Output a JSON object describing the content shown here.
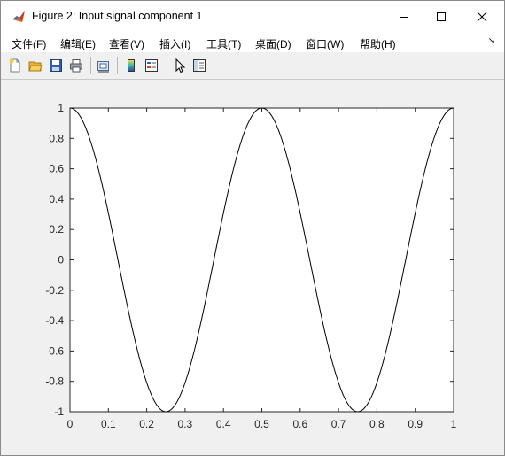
{
  "window": {
    "title": "Figure 2: Input signal component 1",
    "icons": [
      "matlab-logo-icon",
      "minimize-icon",
      "maximize-icon",
      "close-icon"
    ]
  },
  "menubar": {
    "items": [
      {
        "label": "文件(F)"
      },
      {
        "label": "编辑(E)"
      },
      {
        "label": "查看(V)"
      },
      {
        "label": "插入(I)"
      },
      {
        "label": "工具(T)"
      },
      {
        "label": "桌面(D)"
      },
      {
        "label": "窗口(W)"
      },
      {
        "label": "帮助(H)"
      }
    ],
    "overflow_glyph": "↘"
  },
  "toolbar": {
    "buttons": [
      {
        "icon": "new-figure-icon"
      },
      {
        "icon": "open-file-icon"
      },
      {
        "icon": "save-icon"
      },
      {
        "icon": "print-icon"
      },
      {
        "icon": "link-plot-icon"
      },
      {
        "icon": "insert-colorbar-icon"
      },
      {
        "icon": "insert-legend-icon"
      },
      {
        "icon": "edit-plot-pointer-icon"
      },
      {
        "icon": "property-inspector-icon"
      }
    ]
  },
  "chart_data": {
    "type": "line",
    "title": "",
    "xlabel": "",
    "ylabel": "",
    "xlim": [
      0,
      1
    ],
    "ylim": [
      -1,
      1
    ],
    "xticks": [
      "0",
      "0.1",
      "0.2",
      "0.3",
      "0.4",
      "0.5",
      "0.6",
      "0.7",
      "0.8",
      "0.9",
      "1"
    ],
    "yticks": [
      "1",
      "0.8",
      "0.6",
      "0.4",
      "0.2",
      "0",
      "-0.2",
      "-0.4",
      "-0.6",
      "-0.8",
      "-1"
    ],
    "grid": false,
    "series": [
      {
        "function": "y = cos(4*pi*x)",
        "color": "#000000",
        "x": [
          0,
          0.025,
          0.05,
          0.075,
          0.1,
          0.125,
          0.15,
          0.175,
          0.2,
          0.225,
          0.25,
          0.275,
          0.3,
          0.325,
          0.35,
          0.375,
          0.4,
          0.425,
          0.45,
          0.475,
          0.5,
          0.525,
          0.55,
          0.575,
          0.6,
          0.625,
          0.65,
          0.675,
          0.7,
          0.725,
          0.75,
          0.775,
          0.8,
          0.825,
          0.85,
          0.875,
          0.9,
          0.925,
          0.95,
          0.975,
          1
        ],
        "y": [
          1,
          0.951,
          0.809,
          0.588,
          0.309,
          0,
          -0.309,
          -0.588,
          -0.809,
          -0.951,
          -1,
          -0.951,
          -0.809,
          -0.588,
          -0.309,
          0,
          0.309,
          0.588,
          0.809,
          0.951,
          1,
          0.951,
          0.809,
          0.588,
          0.309,
          0,
          -0.309,
          -0.588,
          -0.809,
          -0.951,
          -1,
          -0.951,
          -0.809,
          -0.588,
          -0.309,
          0,
          0.309,
          0.588,
          0.809,
          0.951,
          1
        ]
      }
    ]
  }
}
